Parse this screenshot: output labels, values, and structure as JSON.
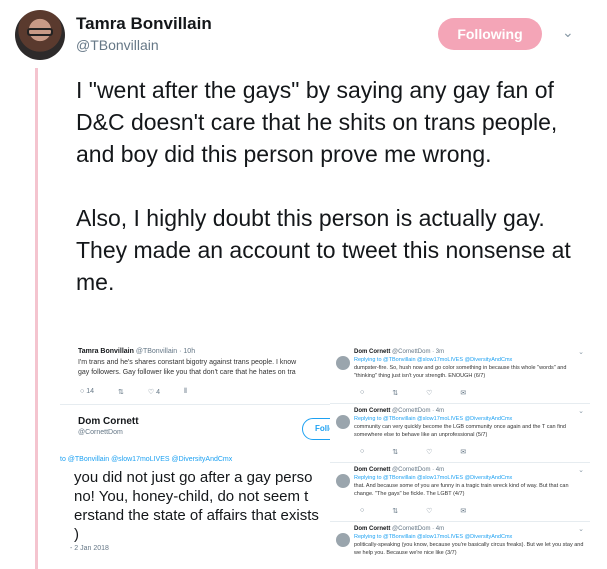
{
  "user": {
    "name": "Tamra Bonvillain",
    "handle": "@TBonvillain",
    "follow_label": "Following"
  },
  "tweet": {
    "paragraphs": [
      "I \"went after the gays\" by saying any gay fan of D&C doesn't care that he shits on trans people, and boy did this person prove me wrong.",
      "Also, I highly doubt this person is actually gay. They made an account to tweet this nonsense at me."
    ]
  },
  "embed_left": {
    "quoted_name": "Tamra Bonvillain",
    "quoted_meta": "@TBonvillain · 10h",
    "quoted_line1": "I'm trans and he's shares constant bigotry against trans people. I know",
    "quoted_line2": "gay followers. Gay follower like you that don't care that he hates on tra",
    "quoted_actions": [
      "14",
      "",
      "4",
      ""
    ],
    "reply_name": "Dom Cornett",
    "reply_handle": "@CornettDom",
    "follow_label": "Follow",
    "replying_to": "to @TBonvillain @slow17moLIVES @DiversityAndCmx",
    "big_line1": "you did not just go after a gay perso",
    "big_line2": "no! You, honey-child, do not seem t",
    "big_line3": "erstand the state of affairs that exists",
    "big_line4": ")",
    "date": "- 2 Jan 2018"
  },
  "embed_right": {
    "tweets": [
      {
        "name": "Dom Cornett",
        "meta": "@CornettDom · 3m",
        "replying": "Replying to @TBonvillain @slow17moLIVES @DiversityAndCmx",
        "body": "dumpster-fire. So, hush now and go color something in because this whole \"words\" and \"thinking\" thing just isn't your strength. ENOUGH (6/7)"
      },
      {
        "name": "Dom Cornett",
        "meta": "@CornettDom · 4m",
        "replying": "Replying to @TBonvillain @slow17moLIVES @DiversityAndCmx",
        "body": "community can very quickly become the LGB community once again and the T can find somewhere else to behave like an unprofessional (5/7)"
      },
      {
        "name": "Dom Cornett",
        "meta": "@CornettDom · 4m",
        "replying": "Replying to @TBonvillain @slow17moLIVES @DiversityAndCmx",
        "body": "that. And because some of you are funny in a tragic train wreck kind of way. But that can change. \"The gays\" be fickle. The LGBT (4/7)"
      },
      {
        "name": "Dom Cornett",
        "meta": "@CornettDom · 4m",
        "replying": "Replying to @TBonvillain @slow17moLIVES @DiversityAndCmx",
        "body": "politically-speaking (you know, because you're basically circus freaks). But we let you stay and we help you. Because we're nice like (3/7)"
      }
    ]
  }
}
